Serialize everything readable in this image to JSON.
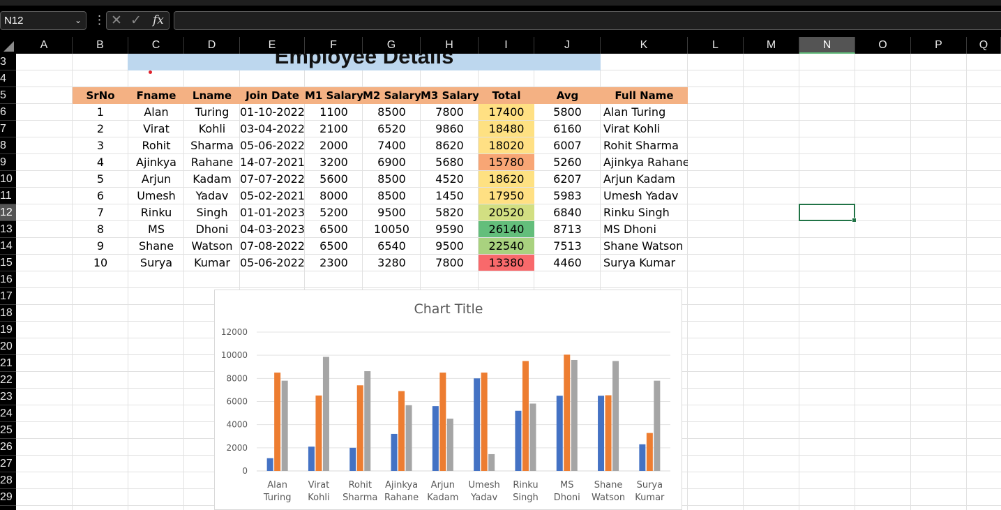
{
  "name_box": "N12",
  "formula_bar": {
    "fx_label": "fx",
    "value": ""
  },
  "columns": [
    "A",
    "B",
    "C",
    "D",
    "E",
    "F",
    "G",
    "H",
    "I",
    "J",
    "K",
    "L",
    "M",
    "N",
    "O",
    "P",
    "Q"
  ],
  "rows": [
    "3",
    "4",
    "5",
    "6",
    "7",
    "8",
    "9",
    "10",
    "11",
    "12",
    "13",
    "14",
    "15",
    "16",
    "17",
    "18",
    "19",
    "20",
    "21",
    "22",
    "23",
    "24",
    "25",
    "26",
    "27",
    "28",
    "29"
  ],
  "selected": {
    "column": "N",
    "row": "12"
  },
  "sheet_title": "Employee Details",
  "table": {
    "headers": [
      "SrNo",
      "Fname",
      "Lname",
      "Join Date",
      "M1 Salary",
      "M2 Salary",
      "M3 Salary",
      "Total",
      "Avg",
      "Full Name"
    ],
    "rows": [
      [
        "1",
        "Alan",
        "Turing",
        "01-10-2022",
        "1100",
        "8500",
        "7800",
        "17400",
        "5800",
        "Alan Turing"
      ],
      [
        "2",
        "Virat",
        "Kohli",
        "03-04-2022",
        "2100",
        "6520",
        "9860",
        "18480",
        "6160",
        "Virat Kohli"
      ],
      [
        "3",
        "Rohit",
        "Sharma",
        "05-06-2022",
        "2000",
        "7400",
        "8620",
        "18020",
        "6007",
        "Rohit Sharma"
      ],
      [
        "4",
        "Ajinkya",
        "Rahane",
        "14-07-2021",
        "3200",
        "6900",
        "5680",
        "15780",
        "5260",
        "Ajinkya Rahane"
      ],
      [
        "5",
        "Arjun",
        "Kadam",
        "07-07-2022",
        "5600",
        "8500",
        "4520",
        "18620",
        "6207",
        "Arjun Kadam"
      ],
      [
        "6",
        "Umesh",
        "Yadav",
        "05-02-2021",
        "8000",
        "8500",
        "1450",
        "17950",
        "5983",
        "Umesh  Yadav"
      ],
      [
        "7",
        "Rinku",
        "Singh",
        "01-01-2023",
        "5200",
        "9500",
        "5820",
        "20520",
        "6840",
        "Rinku Singh"
      ],
      [
        "8",
        "MS",
        "Dhoni",
        "04-03-2023",
        "6500",
        "10050",
        "9590",
        "26140",
        "8713",
        "MS Dhoni"
      ],
      [
        "9",
        "Shane",
        "Watson",
        "07-08-2022",
        "6500",
        "6540",
        "9500",
        "22540",
        "7513",
        "Shane Watson"
      ],
      [
        "10",
        "Surya",
        "Kumar",
        "05-06-2022",
        "2300",
        "3280",
        "7800",
        "13380",
        "4460",
        "Surya  Kumar"
      ]
    ],
    "total_colors": [
      "#ffe083",
      "#fee182",
      "#ffe084",
      "#f8a675",
      "#fee182",
      "#ffe083",
      "#d2df82",
      "#63be7b",
      "#a9d27f",
      "#f8696b"
    ]
  },
  "colors": {
    "header_fill": "#f4b183",
    "title_fill": "#bdd7ee",
    "series": [
      "#4472c4",
      "#ed7d31",
      "#a5a5a5"
    ]
  },
  "chart_data": {
    "type": "bar",
    "title": "Chart Title",
    "categories": [
      "Alan Turing",
      "Virat Kohli",
      "Rohit Sharma",
      "Ajinkya Rahane",
      "Arjun Kadam",
      "Umesh Yadav",
      "Rinku Singh",
      "MS Dhoni",
      "Shane Watson",
      "Surya Kumar"
    ],
    "category_lines": [
      [
        "Alan",
        "Turing"
      ],
      [
        "Virat",
        "Kohli"
      ],
      [
        "Rohit",
        "Sharma"
      ],
      [
        "Ajinkya",
        "Rahane"
      ],
      [
        "Arjun",
        "Kadam"
      ],
      [
        "Umesh",
        "Yadav"
      ],
      [
        "Rinku",
        "Singh"
      ],
      [
        "MS",
        "Dhoni"
      ],
      [
        "Shane",
        "Watson"
      ],
      [
        "Surya",
        "Kumar"
      ]
    ],
    "series": [
      {
        "values": [
          1100,
          2100,
          2000,
          3200,
          5600,
          8000,
          5200,
          6500,
          6500,
          2300
        ]
      },
      {
        "values": [
          8500,
          6520,
          7400,
          6900,
          8500,
          8500,
          9500,
          10050,
          6540,
          3280
        ]
      },
      {
        "values": [
          7800,
          9860,
          8620,
          5680,
          4520,
          1450,
          5820,
          9590,
          9500,
          7800
        ]
      }
    ],
    "yticks": [
      "0",
      "2000",
      "4000",
      "6000",
      "8000",
      "10000",
      "12000"
    ],
    "ylim": [
      0,
      12000
    ],
    "grid": true
  }
}
